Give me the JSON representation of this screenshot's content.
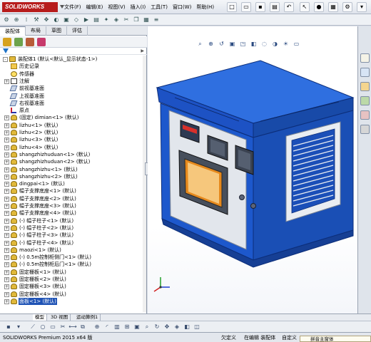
{
  "app": {
    "logo": "SOLIDWORKS",
    "menus": [
      "文件(F)",
      "编辑(E)",
      "视图(V)",
      "插入(I)",
      "工具(T)",
      "窗口(W)",
      "帮助(H)"
    ]
  },
  "panel_tabs": [
    "装配体",
    "布局",
    "草图",
    "评估"
  ],
  "tree": {
    "rows": [
      {
        "label": "装配体1 (默认<默认_显示状态-1>)",
        "indent": 0,
        "icon": "assembly-icon",
        "expander": "-"
      },
      {
        "label": "历史记录",
        "indent": 1,
        "icon": "folder-icon",
        "expander": ""
      },
      {
        "label": "传感器",
        "indent": 1,
        "icon": "sensor-icon",
        "expander": ""
      },
      {
        "label": "注解",
        "indent": 1,
        "icon": "note-icon",
        "expander": "+"
      },
      {
        "label": "前视基准面",
        "indent": 1,
        "icon": "plane-icon",
        "expander": ""
      },
      {
        "label": "上视基准面",
        "indent": 1,
        "icon": "plane-icon",
        "expander": ""
      },
      {
        "label": "右视基准面",
        "indent": 1,
        "icon": "plane-icon",
        "expander": ""
      },
      {
        "label": "原点",
        "indent": 1,
        "icon": "origin-icon",
        "expander": ""
      },
      {
        "label": "(固定) dimian<1> (默认)",
        "indent": 1,
        "icon": "part-icon",
        "expander": "+"
      },
      {
        "label": "lizhu<1> (默认)",
        "indent": 1,
        "icon": "part-icon",
        "expander": "+"
      },
      {
        "label": "lizhu<2> (默认)",
        "indent": 1,
        "icon": "part-icon",
        "expander": "+"
      },
      {
        "label": "lizhu<3> (默认)",
        "indent": 1,
        "icon": "part-icon",
        "expander": "+"
      },
      {
        "label": "lizhu<4> (默认)",
        "indent": 1,
        "icon": "part-icon",
        "expander": "+"
      },
      {
        "label": "shangzhizhuduan<1> (默认)",
        "indent": 1,
        "icon": "part-icon",
        "expander": "+"
      },
      {
        "label": "shangzhizhuduan<2> (默认)",
        "indent": 1,
        "icon": "part-icon",
        "expander": "+"
      },
      {
        "label": "shangzhizhu<1> (默认)",
        "indent": 1,
        "icon": "part-icon",
        "expander": "+"
      },
      {
        "label": "shangzhizhu<2> (默认)",
        "indent": 1,
        "icon": "part-icon",
        "expander": "+"
      },
      {
        "label": "dingpai<1> (默认)",
        "indent": 1,
        "icon": "part-icon",
        "expander": "+"
      },
      {
        "label": "幅子支撑底座<1> (默认)",
        "indent": 1,
        "icon": "part-icon",
        "expander": "+"
      },
      {
        "label": "幅子支撑底座<2> (默认)",
        "indent": 1,
        "icon": "part-icon",
        "expander": "+"
      },
      {
        "label": "幅子支撑底座<3> (默认)",
        "indent": 1,
        "icon": "part-icon",
        "expander": "+"
      },
      {
        "label": "幅子支撑底座<4> (默认)",
        "indent": 1,
        "icon": "part-icon",
        "expander": "+"
      },
      {
        "label": "(-) 幅子柱子<1> (默认)",
        "indent": 1,
        "icon": "part-icon",
        "expander": "+"
      },
      {
        "label": "(-) 幅子柱子<2> (默认)",
        "indent": 1,
        "icon": "part-icon",
        "expander": "+"
      },
      {
        "label": "(-) 幅子柱子<3> (默认)",
        "indent": 1,
        "icon": "part-icon",
        "expander": "+"
      },
      {
        "label": "(-) 幅子柱子<4> (默认)",
        "indent": 1,
        "icon": "part-icon",
        "expander": "+"
      },
      {
        "label": "maozi<1> (默认)",
        "indent": 1,
        "icon": "part-icon",
        "expander": "+"
      },
      {
        "label": "(-) 0.5m控制柜侧门<1> (默认)",
        "indent": 1,
        "icon": "part-icon",
        "expander": "+"
      },
      {
        "label": "(-) 0.5m控制柜后门<1> (默认)",
        "indent": 1,
        "icon": "part-icon",
        "expander": "+"
      },
      {
        "label": "固定栅板<1> (默认)",
        "indent": 1,
        "icon": "part-icon",
        "expander": "+"
      },
      {
        "label": "固定栅板<2> (默认)",
        "indent": 1,
        "icon": "part-icon",
        "expander": "+"
      },
      {
        "label": "固定栅板<3> (默认)",
        "indent": 1,
        "icon": "part-icon",
        "expander": "+"
      },
      {
        "label": "固定栅板<4> (默认)",
        "indent": 1,
        "icon": "part-icon",
        "expander": "+"
      },
      {
        "label": "面板<1> (默认)",
        "indent": 1,
        "icon": "part-icon",
        "expander": "+",
        "selected": true
      }
    ]
  },
  "bottom_tabs": [
    "模型",
    "3D 视图",
    "运动算例1"
  ],
  "status": {
    "product": "SOLIDWORKS Premium 2015 x64 版",
    "state": "欠定义",
    "mode": "在编辑 装配体",
    "custom": "自定义",
    "ime": "拼音主窗体"
  },
  "colors": {
    "cabinet_blue": "#1f5fd1",
    "cabinet_panel": "#e2e6ec",
    "selection": "#1f53b5"
  }
}
